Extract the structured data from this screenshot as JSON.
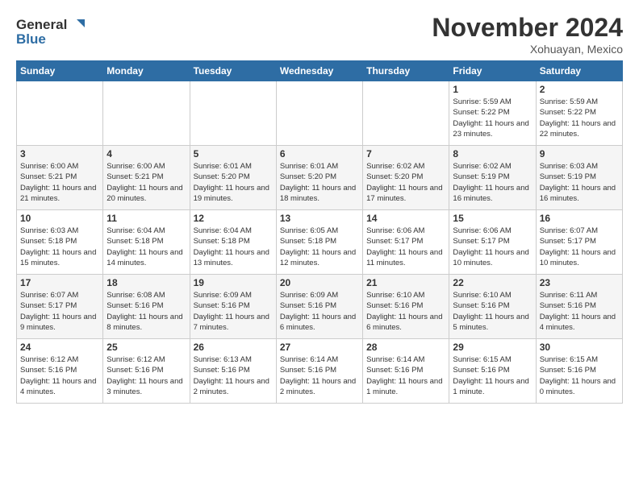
{
  "logo": {
    "line1": "General",
    "line2": "Blue"
  },
  "title": "November 2024",
  "location": "Xohuayan, Mexico",
  "days_of_week": [
    "Sunday",
    "Monday",
    "Tuesday",
    "Wednesday",
    "Thursday",
    "Friday",
    "Saturday"
  ],
  "weeks": [
    [
      {
        "day": "",
        "info": ""
      },
      {
        "day": "",
        "info": ""
      },
      {
        "day": "",
        "info": ""
      },
      {
        "day": "",
        "info": ""
      },
      {
        "day": "",
        "info": ""
      },
      {
        "day": "1",
        "info": "Sunrise: 5:59 AM\nSunset: 5:22 PM\nDaylight: 11 hours\nand 23 minutes."
      },
      {
        "day": "2",
        "info": "Sunrise: 5:59 AM\nSunset: 5:22 PM\nDaylight: 11 hours\nand 22 minutes."
      }
    ],
    [
      {
        "day": "3",
        "info": "Sunrise: 6:00 AM\nSunset: 5:21 PM\nDaylight: 11 hours\nand 21 minutes."
      },
      {
        "day": "4",
        "info": "Sunrise: 6:00 AM\nSunset: 5:21 PM\nDaylight: 11 hours\nand 20 minutes."
      },
      {
        "day": "5",
        "info": "Sunrise: 6:01 AM\nSunset: 5:20 PM\nDaylight: 11 hours\nand 19 minutes."
      },
      {
        "day": "6",
        "info": "Sunrise: 6:01 AM\nSunset: 5:20 PM\nDaylight: 11 hours\nand 18 minutes."
      },
      {
        "day": "7",
        "info": "Sunrise: 6:02 AM\nSunset: 5:20 PM\nDaylight: 11 hours\nand 17 minutes."
      },
      {
        "day": "8",
        "info": "Sunrise: 6:02 AM\nSunset: 5:19 PM\nDaylight: 11 hours\nand 16 minutes."
      },
      {
        "day": "9",
        "info": "Sunrise: 6:03 AM\nSunset: 5:19 PM\nDaylight: 11 hours\nand 16 minutes."
      }
    ],
    [
      {
        "day": "10",
        "info": "Sunrise: 6:03 AM\nSunset: 5:18 PM\nDaylight: 11 hours\nand 15 minutes."
      },
      {
        "day": "11",
        "info": "Sunrise: 6:04 AM\nSunset: 5:18 PM\nDaylight: 11 hours\nand 14 minutes."
      },
      {
        "day": "12",
        "info": "Sunrise: 6:04 AM\nSunset: 5:18 PM\nDaylight: 11 hours\nand 13 minutes."
      },
      {
        "day": "13",
        "info": "Sunrise: 6:05 AM\nSunset: 5:18 PM\nDaylight: 11 hours\nand 12 minutes."
      },
      {
        "day": "14",
        "info": "Sunrise: 6:06 AM\nSunset: 5:17 PM\nDaylight: 11 hours\nand 11 minutes."
      },
      {
        "day": "15",
        "info": "Sunrise: 6:06 AM\nSunset: 5:17 PM\nDaylight: 11 hours\nand 10 minutes."
      },
      {
        "day": "16",
        "info": "Sunrise: 6:07 AM\nSunset: 5:17 PM\nDaylight: 11 hours\nand 10 minutes."
      }
    ],
    [
      {
        "day": "17",
        "info": "Sunrise: 6:07 AM\nSunset: 5:17 PM\nDaylight: 11 hours\nand 9 minutes."
      },
      {
        "day": "18",
        "info": "Sunrise: 6:08 AM\nSunset: 5:16 PM\nDaylight: 11 hours\nand 8 minutes."
      },
      {
        "day": "19",
        "info": "Sunrise: 6:09 AM\nSunset: 5:16 PM\nDaylight: 11 hours\nand 7 minutes."
      },
      {
        "day": "20",
        "info": "Sunrise: 6:09 AM\nSunset: 5:16 PM\nDaylight: 11 hours\nand 6 minutes."
      },
      {
        "day": "21",
        "info": "Sunrise: 6:10 AM\nSunset: 5:16 PM\nDaylight: 11 hours\nand 6 minutes."
      },
      {
        "day": "22",
        "info": "Sunrise: 6:10 AM\nSunset: 5:16 PM\nDaylight: 11 hours\nand 5 minutes."
      },
      {
        "day": "23",
        "info": "Sunrise: 6:11 AM\nSunset: 5:16 PM\nDaylight: 11 hours\nand 4 minutes."
      }
    ],
    [
      {
        "day": "24",
        "info": "Sunrise: 6:12 AM\nSunset: 5:16 PM\nDaylight: 11 hours\nand 4 minutes."
      },
      {
        "day": "25",
        "info": "Sunrise: 6:12 AM\nSunset: 5:16 PM\nDaylight: 11 hours\nand 3 minutes."
      },
      {
        "day": "26",
        "info": "Sunrise: 6:13 AM\nSunset: 5:16 PM\nDaylight: 11 hours\nand 2 minutes."
      },
      {
        "day": "27",
        "info": "Sunrise: 6:14 AM\nSunset: 5:16 PM\nDaylight: 11 hours\nand 2 minutes."
      },
      {
        "day": "28",
        "info": "Sunrise: 6:14 AM\nSunset: 5:16 PM\nDaylight: 11 hours\nand 1 minute."
      },
      {
        "day": "29",
        "info": "Sunrise: 6:15 AM\nSunset: 5:16 PM\nDaylight: 11 hours\nand 1 minute."
      },
      {
        "day": "30",
        "info": "Sunrise: 6:15 AM\nSunset: 5:16 PM\nDaylight: 11 hours\nand 0 minutes."
      }
    ]
  ]
}
